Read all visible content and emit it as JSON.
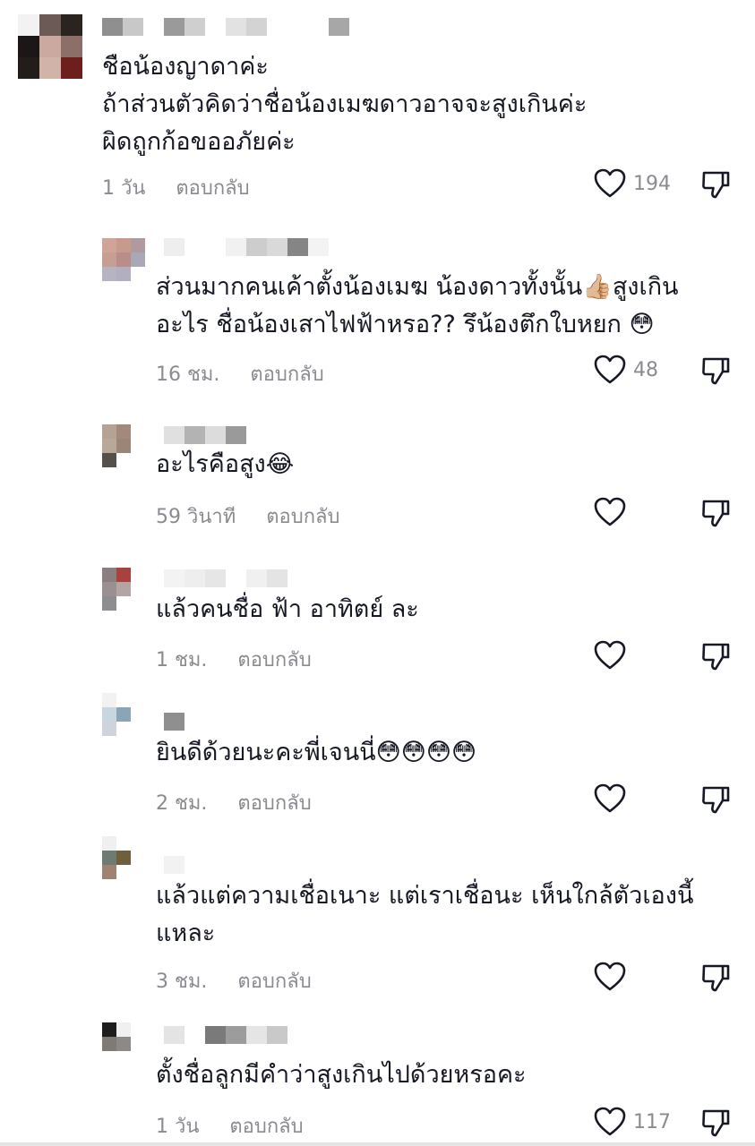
{
  "colors": {
    "text": "#161823",
    "meta": "#8a8b91",
    "icon": "#161823"
  },
  "comments": [
    {
      "text": "ชือน้องญาดาค่ะ\nถ้าส่วนตัวคิดว่าชื่อน้องเมฆดาวอาจจะสูงเกินค่ะ\nผิดถูกก้อขออภัยค่ะ",
      "time": "1 วัน",
      "reply": "ตอบกลับ",
      "likes": "194"
    },
    {
      "text": "ส่วนมากคนเค้าตั้งน้องเมฆ น้องดาวทั้งนั้น👍🏼สูงเกิน\nอะไร ชื่อน้องเสาไฟฟ้าหรอ?? รึน้องตึกใบหยก 😳",
      "time": "16 ชม.",
      "reply": "ตอบกลับ",
      "likes": "48"
    },
    {
      "text": "อะไรคือสูง😂",
      "time": "59 วินาที",
      "reply": "ตอบกลับ",
      "likes": ""
    },
    {
      "text": "แล้วคนชื่อ ฟ้า อาทิตย์ ละ",
      "time": "1 ชม.",
      "reply": "ตอบกลับ",
      "likes": ""
    },
    {
      "text": "ยินดีด้วยนะคะพี่เจนนี่😳😳😳😳",
      "time": "2 ชม.",
      "reply": "ตอบกลับ",
      "likes": ""
    },
    {
      "text": "แล้วแต่ความเชื่อเนาะ แต่เราเชื่อนะ เห็นใกล้ตัวเองนี้\nแหละ",
      "time": "3 ชม.",
      "reply": "ตอบกลับ",
      "likes": ""
    },
    {
      "text": "ตั้งชื่อลูกมีคำว่าสูงเกินไปด้วยหรอคะ",
      "time": "1 วัน",
      "reply": "ตอบกลับ",
      "likes": "117"
    }
  ]
}
